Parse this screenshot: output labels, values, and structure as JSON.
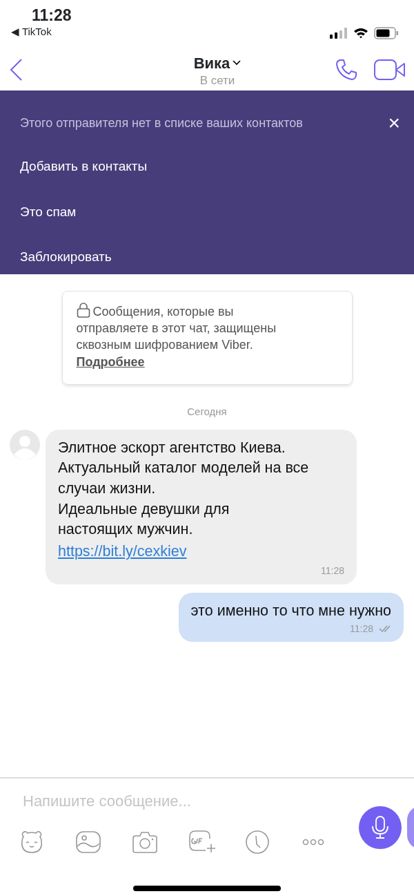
{
  "status_bar": {
    "time": "11:28",
    "back_app": "◀ TikTok"
  },
  "header": {
    "name": "Вика",
    "presence": "В сети"
  },
  "banner": {
    "title": "Этого отправителя нет в списке ваших контактов",
    "close": "×",
    "actions": [
      "Добавить в контакты",
      "Это спам",
      "Заблокировать"
    ]
  },
  "encryption_note": {
    "text": "Сообщения, которые вы\nотправляете в этот чат, защищены\nсквозным шифрованием Viber.",
    "link": "Подробнее"
  },
  "date_divider": "Сегодня",
  "messages": [
    {
      "kind": "incoming",
      "text": "Элитное эскорт агентство Киева.\nАктуальный каталог моделей на все\nслучаи жизни.\nИдеальные девушки для\nнастоящих мужчин.",
      "link": "https://bit.ly/cexkiev",
      "time": "11:28"
    },
    {
      "kind": "outgoing",
      "text": "это именно то что мне нужно",
      "time": "11:28",
      "delivered": true
    }
  ],
  "composer": {
    "placeholder": "Напишите сообщение..."
  }
}
